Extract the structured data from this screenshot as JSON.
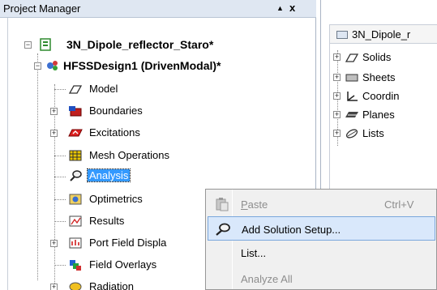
{
  "project_manager": {
    "title": "Project Manager",
    "pin_glyph": "▲",
    "close_glyph": "x",
    "tree": {
      "project": "3N_Dipole_reflector_Staro*",
      "design": "HFSSDesign1 (DrivenModal)*",
      "items": [
        {
          "label": "Model",
          "icon": "model-icon",
          "expandable": false
        },
        {
          "label": "Boundaries",
          "icon": "boundaries-icon",
          "expandable": true
        },
        {
          "label": "Excitations",
          "icon": "excitations-icon",
          "expandable": true
        },
        {
          "label": "Mesh Operations",
          "icon": "mesh-operations-icon",
          "expandable": false
        },
        {
          "label": "Analysis",
          "icon": "analysis-icon",
          "expandable": false,
          "selected": true
        },
        {
          "label": "Optimetrics",
          "icon": "optimetrics-icon",
          "expandable": false
        },
        {
          "label": "Results",
          "icon": "results-icon",
          "expandable": false
        },
        {
          "label": "Port Field Displa",
          "icon": "port-field-display-icon",
          "expandable": true
        },
        {
          "label": "Field Overlays",
          "icon": "field-overlays-icon",
          "expandable": false
        },
        {
          "label": "Radiation",
          "icon": "radiation-icon",
          "expandable": true
        }
      ]
    }
  },
  "modeler": {
    "title": "3N_Dipole_r",
    "tree": [
      {
        "label": "Solids",
        "icon": "solids-icon"
      },
      {
        "label": "Sheets",
        "icon": "sheets-icon"
      },
      {
        "label": "Coordin",
        "icon": "coordinate-systems-icon"
      },
      {
        "label": "Planes",
        "icon": "planes-icon"
      },
      {
        "label": "Lists",
        "icon": "lists-icon"
      }
    ]
  },
  "context_menu": {
    "items": [
      {
        "label": "Paste",
        "underline": "P",
        "shortcut": "Ctrl+V",
        "disabled": true,
        "icon": "paste-icon"
      },
      {
        "label": "Add Solution Setup...",
        "underline": "S",
        "shortcut": "",
        "disabled": false,
        "hover": true,
        "icon": "add-solution-setup-icon"
      },
      {
        "label": "List...",
        "underline": "L",
        "shortcut": "",
        "disabled": false,
        "icon": ""
      },
      {
        "label": "Analyze All",
        "underline": "",
        "shortcut": "",
        "disabled": true,
        "icon": ""
      }
    ]
  },
  "colors": {
    "selection": "#3399ff",
    "menu_hover": "#d9e8fb",
    "title_bar": "#dfe7f2"
  }
}
